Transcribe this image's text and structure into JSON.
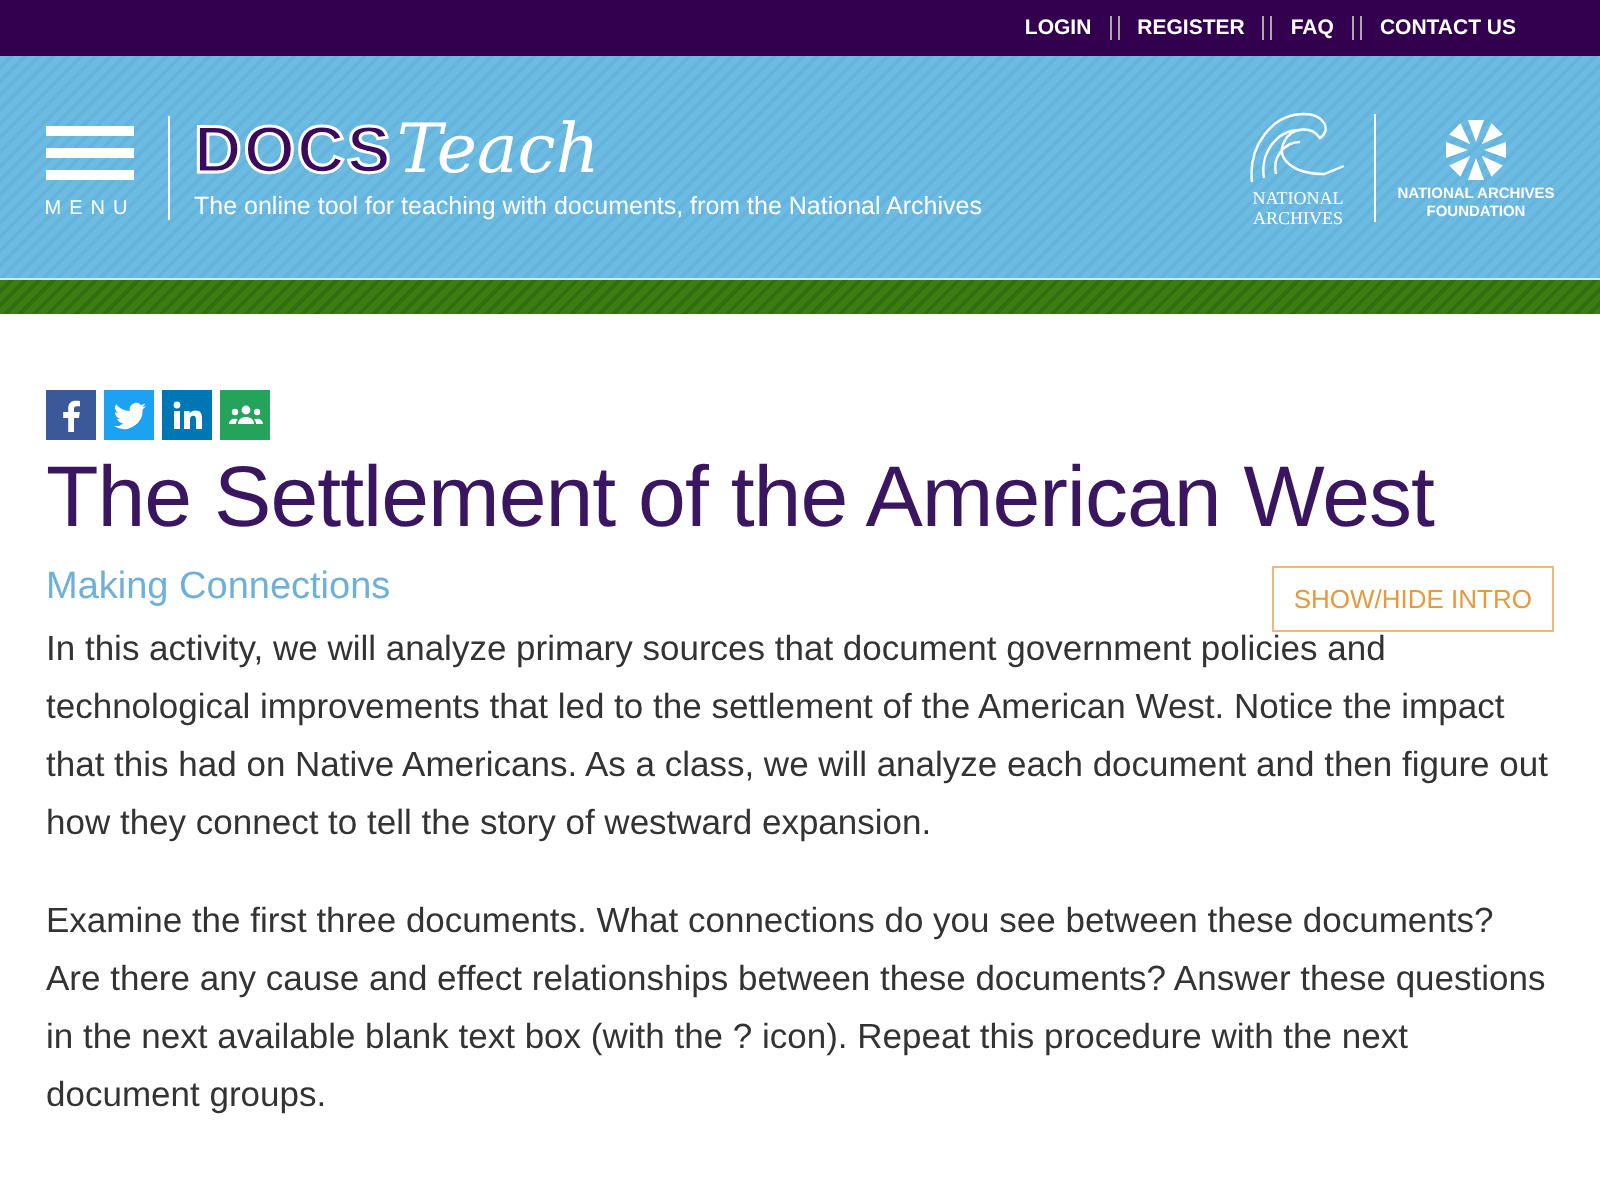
{
  "top_links": [
    "LOGIN",
    "REGISTER",
    "FAQ",
    "CONTACT US"
  ],
  "header": {
    "menu_label": "MENU",
    "logo_bold": "DOCS",
    "logo_script": "Teach",
    "tagline": "The online tool for teaching with documents, from the National Archives",
    "partner_1": "NATIONAL ARCHIVES",
    "partner_2": "NATIONAL ARCHIVES FOUNDATION"
  },
  "share": [
    {
      "kind": "facebook",
      "color": "#3b5998"
    },
    {
      "kind": "twitter",
      "color": "#1da1f2"
    },
    {
      "kind": "linkedin",
      "color": "#0077b5"
    },
    {
      "kind": "classroom",
      "color": "#25a35a"
    }
  ],
  "title": "The Settlement of the American West",
  "subtitle": "Making Connections",
  "intro_button": "SHOW/HIDE INTRO",
  "paragraphs": [
    "In this activity, we will analyze primary sources that document government policies and technological improvements that led to the settlement of the American West. Notice the impact that this had on Native Americans.  As a class, we will analyze each document and then figure out how they connect to tell the story of westward expansion.",
    "Examine the first three documents. What connections do you see between these documents?  Are there any cause and effect relationships between these documents?  Answer these questions in the next available blank text box (with the ? icon).  Repeat this procedure with the next document groups."
  ]
}
